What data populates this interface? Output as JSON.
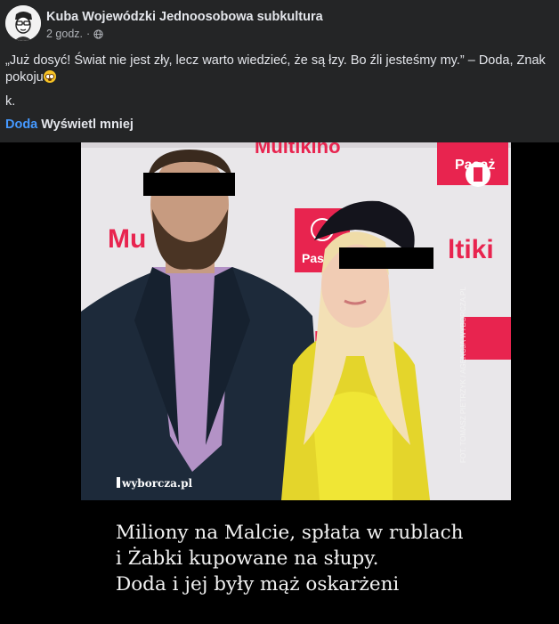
{
  "post": {
    "page_name": "Kuba Wojewódzki Jednoosobowa subkultura",
    "time": "2 godz.",
    "separator": "·",
    "privacy_icon": "globe-icon",
    "text": "„Już dosyć! Świat nie jest zły, lecz warto wiedzieć, że są łzy. Bo źli jesteśmy my.” – Doda, Znak pokoju",
    "emoji": "flushed-face-emoji",
    "line2": "k.",
    "tag": "Doda",
    "see_less": "Wyświetl mniej"
  },
  "image": {
    "watermark": "wyborcza.pl",
    "photo_credit": "FOT. TOMASZ PIETRZYK / AGENCJA WYBORCZA.PL",
    "backdrop_text": [
      "Multikino",
      "Paszport Grunwald"
    ],
    "headline_lines": [
      "Miliony na Malcie, spłata w rublach",
      "i Żabki kupowane na słupy.",
      "Doda i jej były mąż oskarżeni"
    ]
  },
  "colors": {
    "bg": "#242526",
    "link": "#4599ff",
    "backdrop_red": "#e8244f",
    "jacket_yellow": "#e4d52b"
  }
}
